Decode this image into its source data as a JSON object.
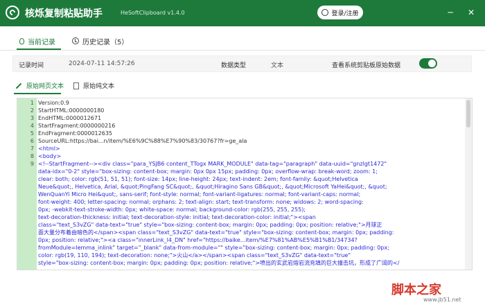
{
  "app": {
    "title": "核烁复制粘贴助手",
    "subtitle": "HeSoftClipboard v1.4.0",
    "login_label": "登录/注册"
  },
  "window": {
    "minimize": "─",
    "close": "✕"
  },
  "tabs": [
    {
      "label": "当前记录",
      "icon": "bulb-icon"
    },
    {
      "label": "历史记录（5）",
      "icon": "clock-icon"
    }
  ],
  "record": {
    "time_label": "记录时间",
    "time_value": "2024-07-11 14:57:26",
    "type_label": "数据类型",
    "type_value": "文本",
    "raw_toggle_label": "查看系统剪贴板原始数据",
    "raw_toggle_on": true
  },
  "subtabs": [
    {
      "label": "原始网页文本"
    },
    {
      "label": "原始纯文本"
    }
  ],
  "editor": {
    "lines": [
      {
        "n": "1",
        "text": "Version:0.9"
      },
      {
        "n": "2",
        "text": "StartHTML:0000000180"
      },
      {
        "n": "3",
        "text": "EndHTML:0000012671"
      },
      {
        "n": "4",
        "text": "StartFragment:0000000216"
      },
      {
        "n": "5",
        "text": "EndFragment:0000012635"
      },
      {
        "n": "6",
        "text": "SourceURL:https://bai...n/item/%E6%9C%88%E7%90%83/30767?fr=ge_ala"
      },
      {
        "n": "7",
        "text": "<html>"
      },
      {
        "n": "8",
        "text": "<body>"
      },
      {
        "n": "9",
        "text": "<!--StartFragment--><div class=\"para_YSJB6 content_TTogx MARK_MODULE\" data-tag=\"paragraph\" data-uuid=\"gnzlgt1472\""
      },
      {
        "n": "",
        "text": "data-idx=\"0-2\" style=\"box-sizing: content-box; margin: 0px 0px 15px; padding: 0px; overflow-wrap: break-word; zoom: 1;"
      },
      {
        "n": "",
        "text": "clear: both; color: rgb(51, 51, 51); font-size: 14px; line-height: 24px; text-indent: 2em; font-family: &quot;Helvetica"
      },
      {
        "n": "",
        "text": "Neue&quot;, Helvetica, Arial, &quot;PingFang SC&quot;, &quot;Hiragino Sans GB&quot;, &quot;Microsoft YaHei&quot;, &quot;"
      },
      {
        "n": "",
        "text": "WenQuanYi Micro Hei&quot;, sans-serif; font-style: normal; font-variant-ligatures: normal; font-variant-caps: normal;"
      },
      {
        "n": "",
        "text": "font-weight: 400; letter-spacing: normal; orphans: 2; text-align: start; text-transform: none; widows: 2; word-spacing:"
      },
      {
        "n": "",
        "text": "0px; -webkit-text-stroke-width: 0px; white-space: normal; background-color: rgb(255, 255, 255);"
      },
      {
        "n": "",
        "text": "text-decoration-thickness: initial; text-decoration-style: initial; text-decoration-color: initial;\"><span"
      },
      {
        "n": "",
        "text": "class=\"text_S3vZG\" data-text=\"true\" style=\"box-sizing: content-box; margin: 0px; padding: 0px; position: relative;\">月球正"
      },
      {
        "n": "",
        "text": "面大量分布着由暗色的</span><span class=\"text_S3vZG\" data-text=\"true\" style=\"box-sizing: content-box; margin: 0px; padding:"
      },
      {
        "n": "",
        "text": "0px; position: relative;\"><a class=\"innerLink_l4_DN\" href=\"https://baike...item/%E7%81%AB%E5%B1%B1/34734?"
      },
      {
        "n": "",
        "text": "fromModule=lemma_inlink\" target=\"_blank\" data-from-module=\"\" style=\"box-sizing: content-box; margin: 0px; padding: 0px;"
      },
      {
        "n": "",
        "text": "color: rgb(19, 110, 194); text-decoration: none;\">火山</a></span><span class=\"text_S3vZG\" data-text=\"true\""
      },
      {
        "n": "",
        "text": "style=\"box-sizing: content-box; margin: 0px; padding: 0px; position: relative;\">喷出的玄武岩熔岩流充填的巨大撞击坑，形成了广阔的</"
      }
    ]
  },
  "watermark": {
    "main": "脚本之家",
    "sub": "www.jb51.net"
  }
}
